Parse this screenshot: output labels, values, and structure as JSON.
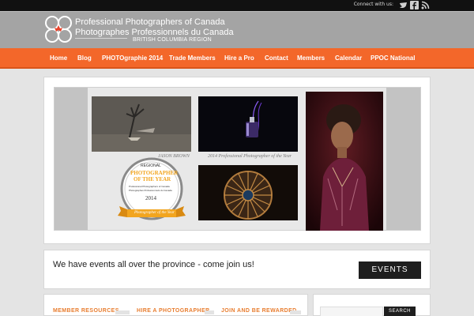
{
  "topbar": {
    "connect_label": "Connect with us:",
    "social_icons": [
      "twitter-icon",
      "facebook-icon",
      "rss-icon"
    ]
  },
  "header": {
    "org_line1": "Professional Photographers of Canada",
    "org_line2": "Photographes Professionnels du Canada",
    "region": "BRITISH COLUMBIA REGION"
  },
  "nav": {
    "items": [
      "Home",
      "Blog",
      "PHOTOgraphie 2014",
      "Trade Members",
      "Hire a Pro",
      "Contact",
      "Members",
      "Calendar",
      "PPOC National"
    ]
  },
  "gallery": {
    "caption_left": "JASON BROWN",
    "caption_right": "2014 Professional Photographer of the Year",
    "badge": {
      "top": "REGIONAL",
      "title_line1": "PHOTOGRAPHER",
      "title_line2": "OF THE YEAR",
      "org1": "Professional Photographers of Canada",
      "org2": "Photographes Professionnels du Canada",
      "year": "2014",
      "ribbon": "Photographer of the Year"
    }
  },
  "events": {
    "text": "We have events all over the province - come join us!",
    "button": "EVENTS"
  },
  "bottom": {
    "headings": [
      "MEMBER RESOURCES",
      "HIRE A PHOTOGRAPHER",
      "JOIN AND BE REWARDED"
    ],
    "search_button": "SEARCH"
  },
  "colors": {
    "accent_orange": "#f3672a",
    "header_grey": "#a4a4a4",
    "topbar": "#111111"
  }
}
